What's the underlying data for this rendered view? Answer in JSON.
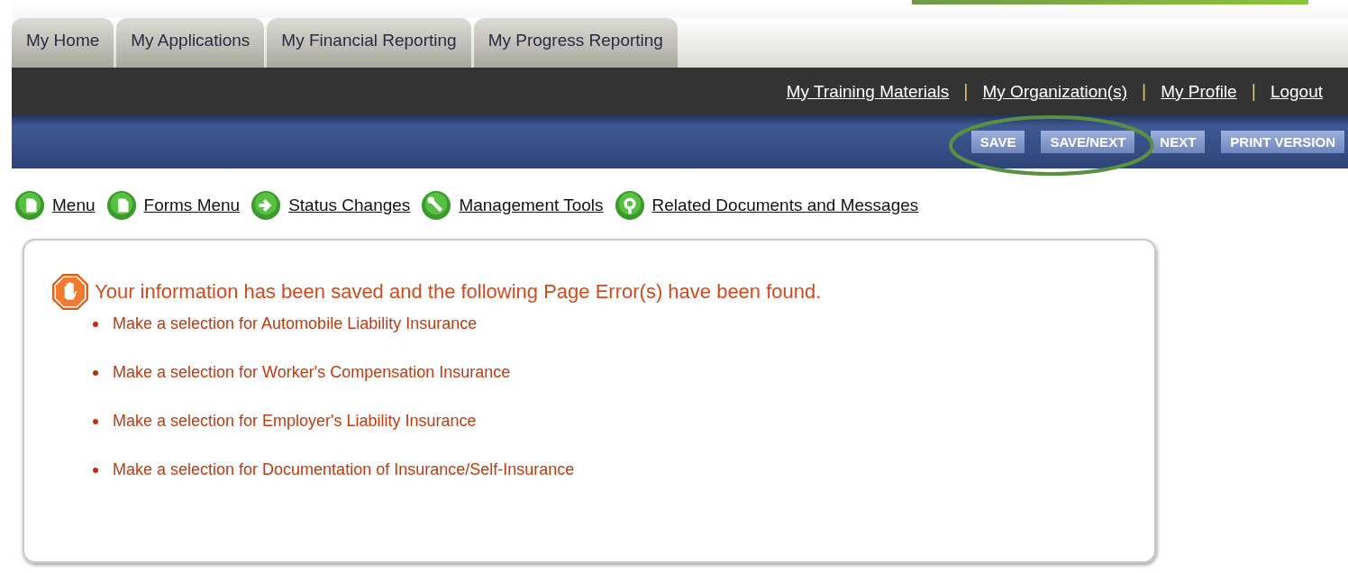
{
  "tabs": [
    {
      "label": "My Home",
      "selected": false
    },
    {
      "label": "My Applications",
      "selected": false
    },
    {
      "label": "My Financial Reporting",
      "selected": false
    },
    {
      "label": "My Progress Reporting",
      "selected": false
    }
  ],
  "user_links": [
    "My Training Materials",
    "My Organization(s)",
    "My Profile",
    "Logout"
  ],
  "separator": "|",
  "circled_buttons": [
    "SAVE",
    "SAVE/NEXT"
  ],
  "action_buttons": [
    "NEXT",
    "PRINT VERSION"
  ],
  "nav_links": [
    "Menu",
    "Forms Menu",
    "Status Changes",
    "Management Tools",
    "Related Documents and Messages"
  ],
  "error_panel": {
    "message": "Your information has been saved and the following Page Error(s) have been found.",
    "errors": [
      "Make a selection for Automobile Liability Insurance",
      "Make a selection for Worker's Compensation Insurance",
      "Make a selection for Employer's Liability Insurance",
      "Make a selection for Documentation of Insurance/Self-Insurance"
    ]
  }
}
